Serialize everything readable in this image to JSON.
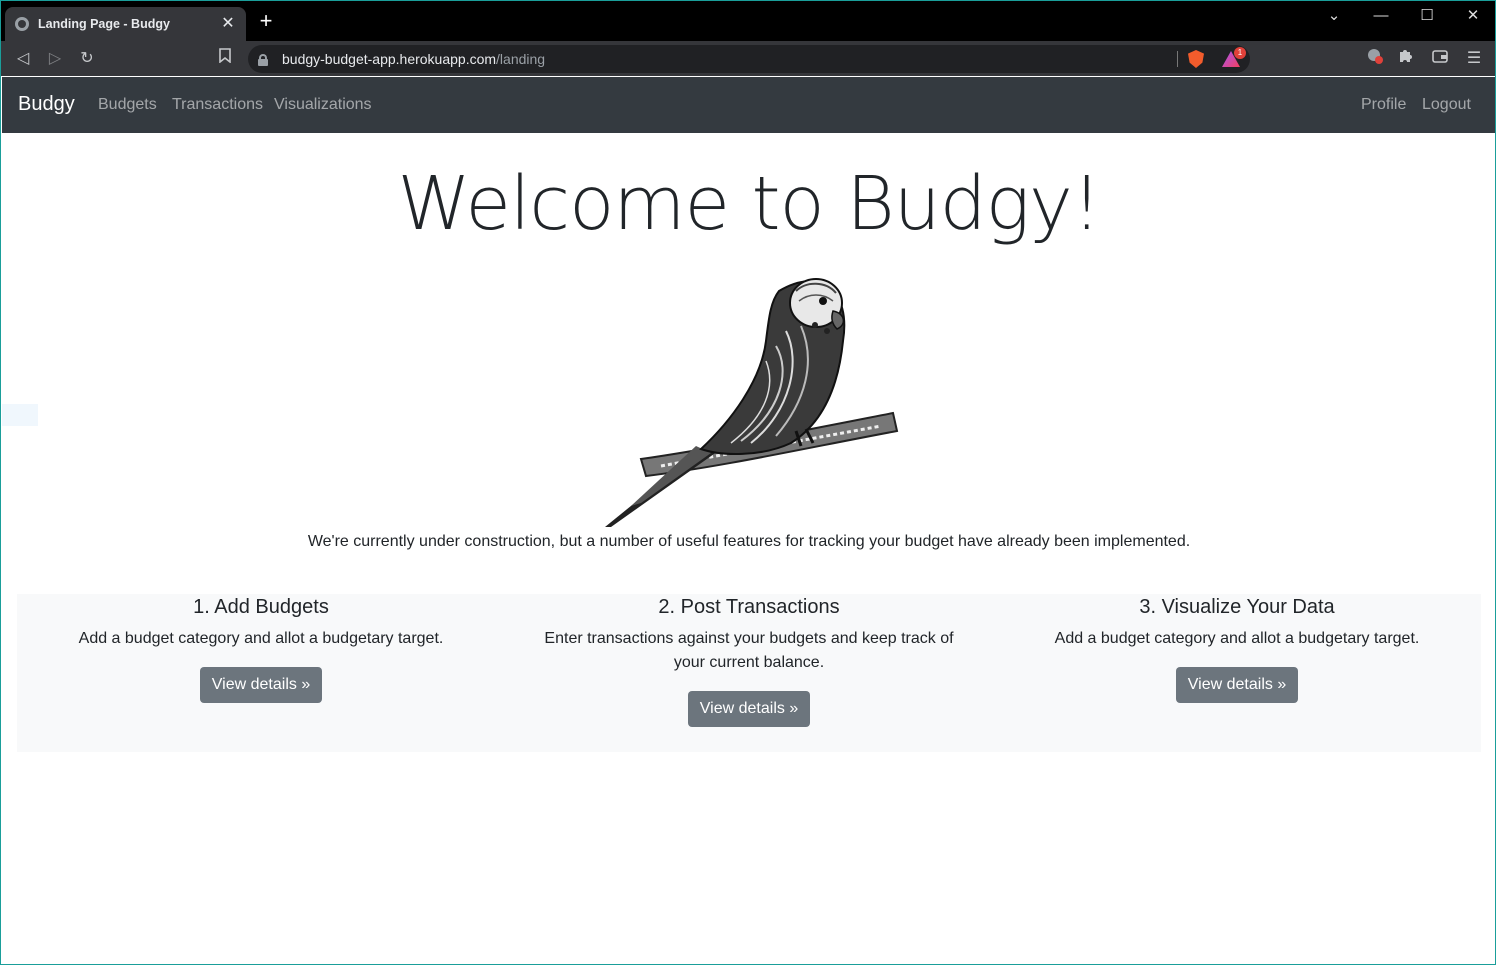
{
  "browser": {
    "tab_title": "Landing Page - Budgy",
    "tab_close": "✕",
    "new_tab": "+",
    "url_host": "budgy-budget-app.herokuapp.com",
    "url_path": "/landing",
    "rewards_count": "1"
  },
  "navbar": {
    "brand": "Budgy",
    "links": [
      "Budgets",
      "Transactions",
      "Visualizations"
    ],
    "right_links": [
      "Profile",
      "Logout"
    ]
  },
  "main": {
    "title": "Welcome to Budgy!",
    "lead": "We're currently under construction, but a number of useful features for tracking your budget have already been implemented.",
    "features": [
      {
        "heading": "1. Add Budgets",
        "text": "Add a budget category and allot a budgetary target.",
        "button": "View details »"
      },
      {
        "heading": "2. Post Transactions",
        "text": "Enter transactions against your budgets and keep track of your current balance.",
        "button": "View details »"
      },
      {
        "heading": "3. Visualize Your Data",
        "text": "Add a budget category and allot a budgetary target.",
        "button": "View details »"
      }
    ]
  },
  "colors": {
    "navbar_bg": "#343a40",
    "button_bg": "#6c757d",
    "features_bg": "#f8f9fa"
  }
}
